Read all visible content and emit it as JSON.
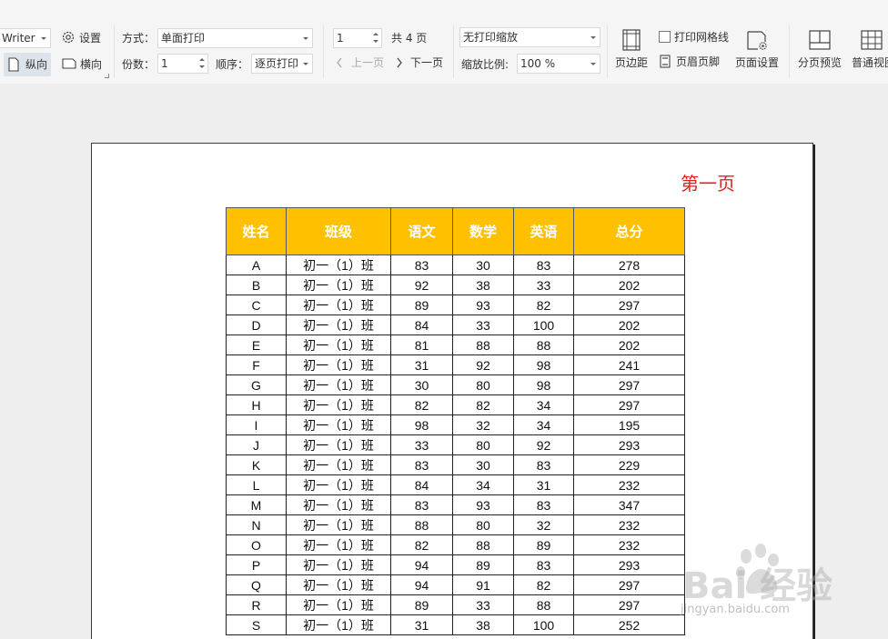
{
  "toolbar": {
    "printer": {
      "value": "Writer"
    },
    "settings_label": "设置",
    "portrait_label": "纵向",
    "landscape_label": "横向",
    "mode_label": "方式：",
    "mode_value": "单面打印",
    "copies_label": "份数：",
    "copies_value": "1",
    "order_label": "顺序：",
    "order_value": "逐页打印",
    "page_value": "1",
    "total_pages": "共 4 页",
    "prev_label": "上一页",
    "next_label": "下一页",
    "scaling_value": "无打印缩放",
    "zoom_label": "缩放比例:",
    "zoom_value": "100 %",
    "margins_label": "页边距",
    "gridlines_label": "打印网格线",
    "header_footer_label": "页眉页脚",
    "page_setup_label": "页面设置",
    "page_break_label": "分页预览",
    "normal_view_label": "普通视图"
  },
  "page": {
    "title": "第一页"
  },
  "table": {
    "headers": [
      "姓名",
      "班级",
      "语文",
      "数学",
      "英语",
      "总分"
    ],
    "rows": [
      [
        "A",
        "初一（1）班",
        "83",
        "30",
        "83",
        "278"
      ],
      [
        "B",
        "初一（1）班",
        "92",
        "38",
        "33",
        "202"
      ],
      [
        "C",
        "初一（1）班",
        "89",
        "93",
        "82",
        "297"
      ],
      [
        "D",
        "初一（1）班",
        "84",
        "33",
        "100",
        "202"
      ],
      [
        "E",
        "初一（1）班",
        "81",
        "88",
        "88",
        "202"
      ],
      [
        "F",
        "初一（1）班",
        "31",
        "92",
        "98",
        "241"
      ],
      [
        "G",
        "初一（1）班",
        "30",
        "80",
        "98",
        "297"
      ],
      [
        "H",
        "初一（1）班",
        "82",
        "82",
        "34",
        "297"
      ],
      [
        "I",
        "初一（1）班",
        "98",
        "32",
        "34",
        "195"
      ],
      [
        "J",
        "初一（1）班",
        "33",
        "80",
        "92",
        "293"
      ],
      [
        "K",
        "初一（1）班",
        "83",
        "30",
        "83",
        "229"
      ],
      [
        "L",
        "初一（1）班",
        "84",
        "34",
        "31",
        "232"
      ],
      [
        "M",
        "初一（1）班",
        "83",
        "93",
        "83",
        "347"
      ],
      [
        "N",
        "初一（1）班",
        "88",
        "80",
        "32",
        "232"
      ],
      [
        "O",
        "初一（1）班",
        "82",
        "88",
        "89",
        "232"
      ],
      [
        "P",
        "初一（1）班",
        "94",
        "89",
        "83",
        "293"
      ],
      [
        "Q",
        "初一（1）班",
        "94",
        "91",
        "82",
        "297"
      ],
      [
        "R",
        "初一（1）班",
        "89",
        "33",
        "88",
        "297"
      ],
      [
        "S",
        "初一（1）班",
        "31",
        "38",
        "100",
        "252"
      ]
    ]
  },
  "watermark": {
    "text": "Bai 经验",
    "url": "jingyan.baidu.com"
  },
  "colors": {
    "header_fill": "#ffc000",
    "title_red": "#e02020"
  }
}
